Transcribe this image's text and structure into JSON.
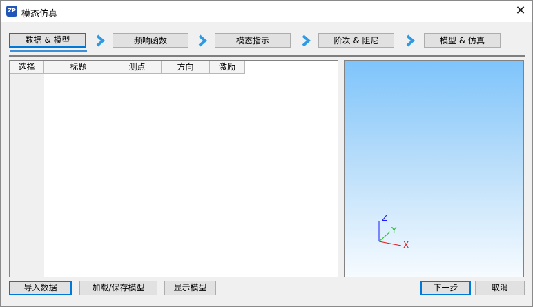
{
  "window": {
    "title": "模态仿真",
    "app_icon_text": "ZP",
    "close_glyph": "✕"
  },
  "steps": [
    {
      "label": "数据 & 模型",
      "active": true
    },
    {
      "label": "频响函数",
      "active": false
    },
    {
      "label": "模态指示",
      "active": false
    },
    {
      "label": "阶次 & 阻尼",
      "active": false
    },
    {
      "label": "模型 & 仿真",
      "active": false
    }
  ],
  "table": {
    "columns": [
      "选择",
      "标题",
      "测点",
      "方向",
      "激励"
    ],
    "rows": []
  },
  "viewer": {
    "axis_labels": {
      "z": "Z",
      "y": "Y",
      "x": "X"
    },
    "colors": {
      "z": "#1a1aff",
      "y": "#18c018",
      "x": "#e01818"
    }
  },
  "buttons": {
    "import": "导入数据",
    "load_save": "加载/保存模型",
    "show_model": "显示模型",
    "next": "下一步",
    "cancel": "取消"
  }
}
